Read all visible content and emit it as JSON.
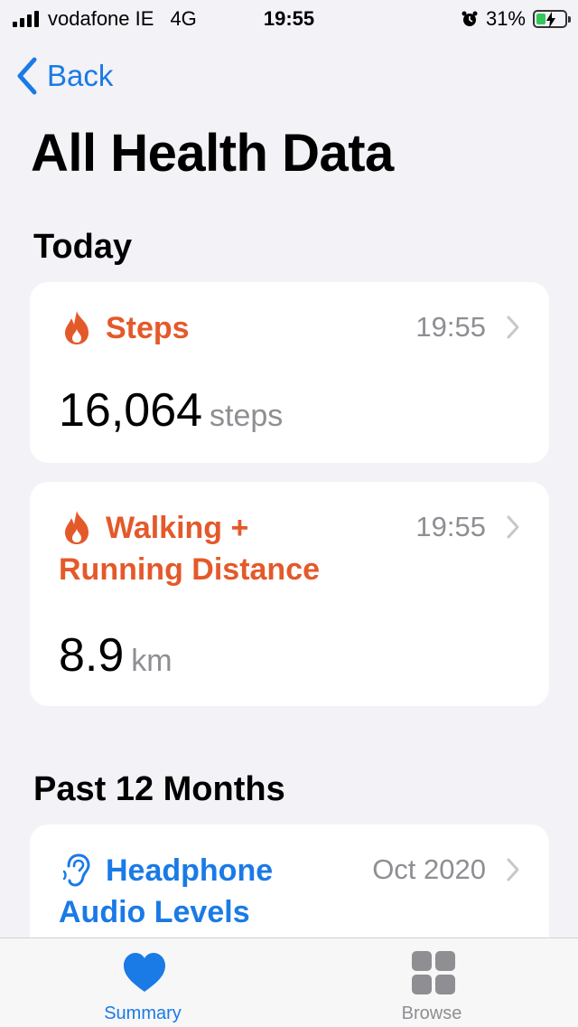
{
  "status_bar": {
    "carrier": "vodafone IE",
    "network": "4G",
    "time": "19:55",
    "battery": "31%"
  },
  "nav": {
    "back_label": "Back"
  },
  "page_title": "All Health Data",
  "sections": {
    "today": "Today",
    "past": "Past 12 Months"
  },
  "cards": {
    "steps": {
      "title": "Steps",
      "time": "19:55",
      "value": "16,064",
      "unit": "steps"
    },
    "walking": {
      "title_line1": "Walking +",
      "title_line2": "Running Distance",
      "time": "19:55",
      "value": "8.9",
      "unit": "km"
    },
    "headphone": {
      "title_line1": "Headphone",
      "title_line2": "Audio Levels",
      "time": "Oct 2020"
    }
  },
  "tabs": {
    "summary": "Summary",
    "browse": "Browse"
  },
  "colors": {
    "accent": "#1a7ae6",
    "activity": "#e4592a",
    "battery": "#34c759"
  },
  "icons": {
    "activity": "flame-icon",
    "hearing": "ear-icon",
    "summary": "heart-icon",
    "browse": "grid-icon"
  }
}
